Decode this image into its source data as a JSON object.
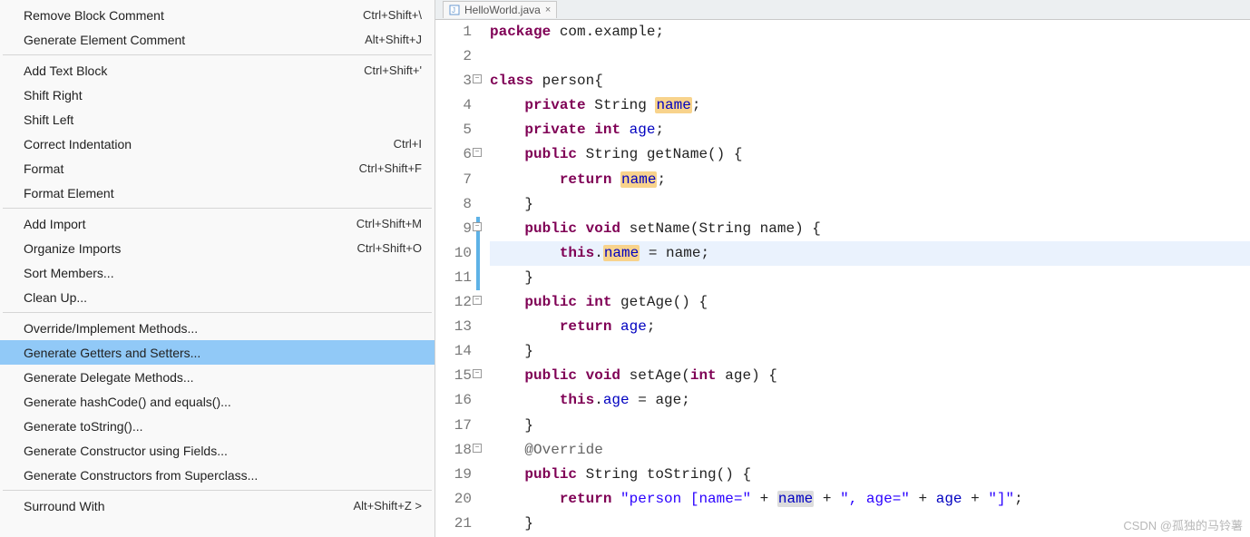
{
  "menu": {
    "groups": [
      [
        {
          "label": "Remove Block Comment",
          "shortcut": "Ctrl+Shift+\\"
        },
        {
          "label": "Generate Element Comment",
          "shortcut": "Alt+Shift+J"
        }
      ],
      [
        {
          "label": "Add Text Block",
          "shortcut": "Ctrl+Shift+'"
        },
        {
          "label": "Shift Right",
          "shortcut": ""
        },
        {
          "label": "Shift Left",
          "shortcut": ""
        },
        {
          "label": "Correct Indentation",
          "shortcut": "Ctrl+I"
        },
        {
          "label": "Format",
          "shortcut": "Ctrl+Shift+F"
        },
        {
          "label": "Format Element",
          "shortcut": ""
        }
      ],
      [
        {
          "label": "Add Import",
          "shortcut": "Ctrl+Shift+M"
        },
        {
          "label": "Organize Imports",
          "shortcut": "Ctrl+Shift+O"
        },
        {
          "label": "Sort Members...",
          "shortcut": ""
        },
        {
          "label": "Clean Up...",
          "shortcut": ""
        }
      ],
      [
        {
          "label": "Override/Implement Methods...",
          "shortcut": ""
        },
        {
          "label": "Generate Getters and Setters...",
          "shortcut": "",
          "highlighted": true
        },
        {
          "label": "Generate Delegate Methods...",
          "shortcut": ""
        },
        {
          "label": "Generate hashCode() and equals()...",
          "shortcut": ""
        },
        {
          "label": "Generate toString()...",
          "shortcut": ""
        },
        {
          "label": "Generate Constructor using Fields...",
          "shortcut": ""
        },
        {
          "label": "Generate Constructors from Superclass...",
          "shortcut": ""
        }
      ],
      [
        {
          "label": "Surround With",
          "shortcut": "Alt+Shift+Z >"
        }
      ]
    ]
  },
  "tab": {
    "filename": "HelloWorld.java",
    "close": "×"
  },
  "code": {
    "lines": [
      {
        "n": 1,
        "html": "<span class='kw'>package</span> com.example;"
      },
      {
        "n": 2,
        "html": ""
      },
      {
        "n": 3,
        "html": "<span class='kw'>class</span> person{",
        "fold": true
      },
      {
        "n": 4,
        "html": "    <span class='kw'>private</span> String <span class='hl-write field'>name</span>;"
      },
      {
        "n": 5,
        "html": "    <span class='kw'>private</span> <span class='kw'>int</span> <span class='field'>age</span>;"
      },
      {
        "n": 6,
        "html": "    <span class='kw'>public</span> String getName() {",
        "fold": true
      },
      {
        "n": 7,
        "html": "        <span class='kw'>return</span> <span class='hl-write field'>name</span>;"
      },
      {
        "n": 8,
        "html": "    }"
      },
      {
        "n": 9,
        "html": "    <span class='kw'>public</span> <span class='kw'>void</span> setName(String name) {",
        "fold": true,
        "mark": true
      },
      {
        "n": 10,
        "html": "        <span class='kw'>this</span>.<span class='hl-write field'>name</span> = name;",
        "cur": true,
        "mark": true
      },
      {
        "n": 11,
        "html": "    }",
        "mark": true
      },
      {
        "n": 12,
        "html": "    <span class='kw'>public</span> <span class='kw'>int</span> getAge() {",
        "fold": true
      },
      {
        "n": 13,
        "html": "        <span class='kw'>return</span> <span class='field'>age</span>;"
      },
      {
        "n": 14,
        "html": "    }"
      },
      {
        "n": 15,
        "html": "    <span class='kw'>public</span> <span class='kw'>void</span> setAge(<span class='kw'>int</span> age) {",
        "fold": true
      },
      {
        "n": 16,
        "html": "        <span class='kw'>this</span>.<span class='field'>age</span> = age;"
      },
      {
        "n": 17,
        "html": "    }"
      },
      {
        "n": 18,
        "html": "    <span class='ann'>@Override</span>",
        "fold": true
      },
      {
        "n": 19,
        "html": "    <span class='kw'>public</span> String toString() {"
      },
      {
        "n": 20,
        "html": "        <span class='kw'>return</span> <span class='str'>\"person [name=\"</span> + <span class='hl-read field'>name</span> + <span class='str'>\", age=\"</span> + <span class='field'>age</span> + <span class='str'>\"]\"</span>;"
      },
      {
        "n": 21,
        "html": "    }"
      }
    ]
  },
  "watermark": "CSDN @孤独的马铃薯"
}
